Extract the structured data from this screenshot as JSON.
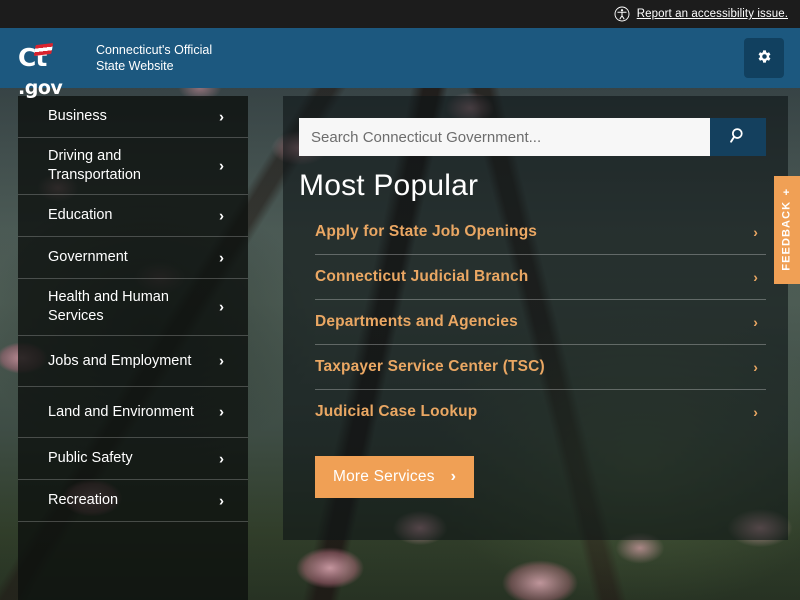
{
  "accessibility_bar": {
    "icon": "accessibility-icon",
    "link_label": "Report an accessibility issue."
  },
  "header": {
    "logo_primary": "Ct",
    "logo_suffix": ".gov",
    "tagline_line1": "Connecticut's Official",
    "tagline_line2": "State Website",
    "settings_icon": "gear-icon",
    "background_color": "#1c587f"
  },
  "sidebar": {
    "items": [
      {
        "label": "Business",
        "chevron": "›"
      },
      {
        "label": "Driving and Transportation",
        "chevron": "›"
      },
      {
        "label": "Education",
        "chevron": "›"
      },
      {
        "label": "Government",
        "chevron": "›"
      },
      {
        "label": "Health and Human Services",
        "chevron": "›"
      },
      {
        "label": "Jobs and Employment",
        "chevron": "›"
      },
      {
        "label": "Land and Environment",
        "chevron": "›"
      },
      {
        "label": "Public Safety",
        "chevron": "›"
      },
      {
        "label": "Recreation",
        "chevron": "›"
      }
    ]
  },
  "search": {
    "value": "",
    "placeholder": "Search Connecticut Government...",
    "button_icon": "search-icon",
    "button_color": "#14405e"
  },
  "main": {
    "title": "Most Popular",
    "links": [
      {
        "label": "Apply for State Job Openings",
        "chevron": "›"
      },
      {
        "label": "Connecticut Judicial Branch",
        "chevron": "›"
      },
      {
        "label": "Departments and Agencies",
        "chevron": "›"
      },
      {
        "label": "Taxpayer Service Center (TSC)",
        "chevron": "›"
      },
      {
        "label": "Judicial Case Lookup",
        "chevron": "›"
      }
    ],
    "link_color": "#eaa763",
    "more_button": {
      "label": "More Services",
      "chevron": "›",
      "color": "#f0a055"
    }
  },
  "feedback": {
    "label": "FEEDBACK",
    "plus": "+",
    "color": "#f0a055"
  }
}
